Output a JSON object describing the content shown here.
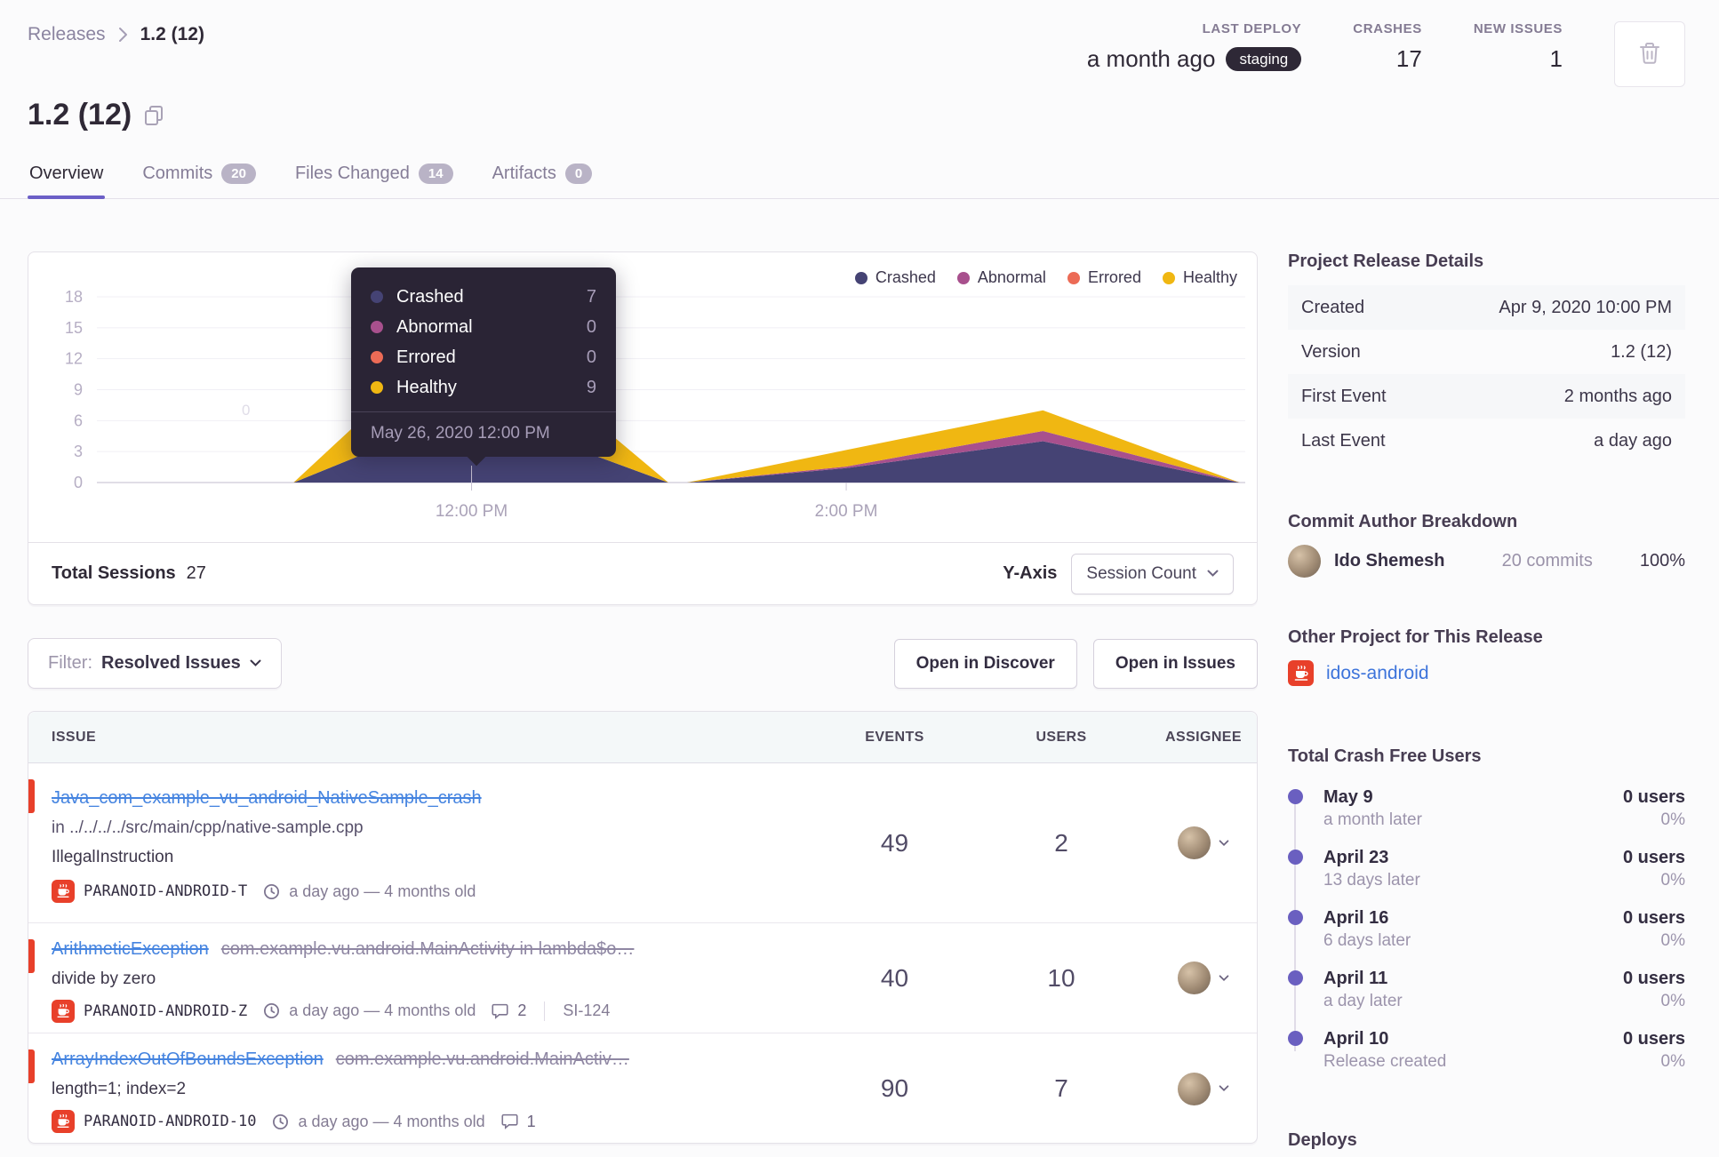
{
  "breadcrumb": {
    "parent": "Releases",
    "current": "1.2 (12)"
  },
  "header_stats": {
    "last_deploy": {
      "label": "LAST DEPLOY",
      "value": "a month ago",
      "badge": "staging"
    },
    "crashes": {
      "label": "CRASHES",
      "value": "17"
    },
    "new_issues": {
      "label": "NEW ISSUES",
      "value": "1"
    }
  },
  "page_title": "1.2 (12)",
  "tabs": [
    {
      "label": "Overview"
    },
    {
      "label": "Commits",
      "badge": "20"
    },
    {
      "label": "Files Changed",
      "badge": "14"
    },
    {
      "label": "Artifacts",
      "badge": "0"
    }
  ],
  "chart_data": {
    "type": "area",
    "stacked": true,
    "title": "Release sessions over time",
    "ylabel": "Session Count",
    "ylim": [
      0,
      18
    ],
    "yticks": [
      0,
      3,
      6,
      9,
      12,
      15,
      18
    ],
    "xticks": [
      {
        "label": "12:00 PM",
        "hour": 12
      },
      {
        "label": "2:00 PM",
        "hour": 14
      }
    ],
    "legend": [
      "Crashed",
      "Abnormal",
      "Errored",
      "Healthy"
    ],
    "legend_position": "top-right",
    "grid": true,
    "colors": {
      "Crashed": "#454374",
      "Abnormal": "#a8508d",
      "Errored": "#ec6b56",
      "Healthy": "#f0b712"
    },
    "x_hours": [
      11.05,
      12,
      13.05,
      13.15,
      14,
      15.05,
      16.1
    ],
    "series": [
      {
        "name": "Crashed",
        "values": [
          0,
          7,
          0,
          0,
          1.4,
          4,
          0
        ]
      },
      {
        "name": "Abnormal",
        "values": [
          0,
          0,
          0,
          0,
          0.15,
          1,
          0
        ]
      },
      {
        "name": "Errored",
        "values": [
          0,
          0,
          0,
          0,
          0,
          0,
          0
        ]
      },
      {
        "name": "Healthy",
        "values": [
          0,
          9,
          0,
          0,
          1.6,
          2,
          0
        ]
      }
    ],
    "ghost_label": "0",
    "tooltip": {
      "hour": 12,
      "rows": [
        [
          "Crashed",
          "7"
        ],
        [
          "Abnormal",
          "0"
        ],
        [
          "Errored",
          "0"
        ],
        [
          "Healthy",
          "9"
        ]
      ],
      "date": "May 26, 2020 12:00 PM"
    }
  },
  "chart_footer": {
    "total_sessions_label": "Total Sessions",
    "total_sessions_value": "27",
    "y_axis_label": "Y-Axis",
    "y_axis_value": "Session Count"
  },
  "filter_bar": {
    "filter_label": "Filter:",
    "filter_value": "Resolved Issues",
    "open_discover": "Open in Discover",
    "open_issues": "Open in Issues"
  },
  "issues_table": {
    "headers": [
      "ISSUE",
      "EVENTS",
      "USERS",
      "ASSIGNEE"
    ],
    "rows": [
      {
        "title": "Java_com_example_vu_android_NativeSample_crash",
        "culprit": "",
        "path": "in ../../../../src/main/cpp/native-sample.cpp",
        "message": "IllegalInstruction",
        "project": "PARANOID-ANDROID-T",
        "age": "a day ago — 4 months old",
        "events": "49",
        "users": "2"
      },
      {
        "title": "ArithmeticException",
        "culprit": "com.example.vu.android.MainActivity in lambda$o…",
        "message": "divide by zero",
        "project": "PARANOID-ANDROID-Z",
        "age": "a day ago — 4 months old",
        "comments": "2",
        "short_id": "SI-124",
        "events": "40",
        "users": "10"
      },
      {
        "title": "ArrayIndexOutOfBoundsException",
        "culprit": "com.example.vu.android.MainActiv…",
        "message": "length=1; index=2",
        "project": "PARANOID-ANDROID-10",
        "age": "a day ago — 4 months old",
        "comments": "1",
        "events": "90",
        "users": "7"
      }
    ]
  },
  "sidebar": {
    "release_details": {
      "title": "Project Release Details",
      "rows": [
        {
          "label": "Created",
          "value": "Apr 9, 2020 10:00 PM"
        },
        {
          "label": "Version",
          "value": "1.2 (12)"
        },
        {
          "label": "First Event",
          "value": "2 months ago"
        },
        {
          "label": "Last Event",
          "value": "a day ago"
        }
      ]
    },
    "commit_authors": {
      "title": "Commit Author Breakdown",
      "author": {
        "name": "Ido Shemesh",
        "commits": "20 commits",
        "percent": "100%"
      }
    },
    "other_project": {
      "title": "Other Project for This Release",
      "project": "idos-android"
    },
    "crash_free": {
      "title": "Total Crash Free Users",
      "items": [
        {
          "date": "May 9",
          "desc": "a month later",
          "users": "0 users",
          "percent": "0%"
        },
        {
          "date": "April 23",
          "desc": "13 days later",
          "users": "0 users",
          "percent": "0%"
        },
        {
          "date": "April 16",
          "desc": "6 days later",
          "users": "0 users",
          "percent": "0%"
        },
        {
          "date": "April 11",
          "desc": "a day later",
          "users": "0 users",
          "percent": "0%"
        },
        {
          "date": "April 10",
          "desc": "Release created",
          "users": "0 users",
          "percent": "0%"
        }
      ]
    },
    "deploys_title": "Deploys"
  },
  "colors": {
    "accent": "#6c5fc7",
    "link": "#3d74db",
    "alert_red": "#e8402a",
    "staging_badge_bg": "#2e2836"
  }
}
